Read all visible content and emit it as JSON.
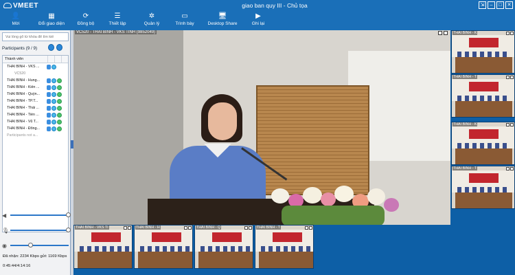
{
  "window": {
    "brand": "VMEET",
    "title": "giao ban quy III - Chủ tọa",
    "controls": [
      "restore",
      "minimize",
      "maximize",
      "close"
    ]
  },
  "toolbar": {
    "items": [
      {
        "label": "Mời",
        "icon": "add-user-icon"
      },
      {
        "label": "Đổi giao diện",
        "icon": "layout-icon"
      },
      {
        "label": "Đồng bộ",
        "icon": "sync-icon"
      },
      {
        "label": "Thiết lập",
        "icon": "settings-sliders-icon"
      },
      {
        "label": "Quản lý",
        "icon": "manage-icon"
      },
      {
        "label": "Trình bày",
        "icon": "present-icon"
      },
      {
        "label": "Desktop Share",
        "icon": "desktop-share-icon"
      },
      {
        "label": "Ghi lại",
        "icon": "record-icon"
      }
    ]
  },
  "sidebar": {
    "search_placeholder": "Vui lòng gõ từ khóa để tìm kiế",
    "participants_title": "Participants (9 / 9)",
    "column_header": "Thành viên",
    "participants": [
      {
        "name": "THÁI BÌNH - VKS ...",
        "icons": [
          "mic",
          "cam"
        ]
      },
      {
        "name": "VC520",
        "sub": true
      },
      {
        "name": "THÁI BÌNH - Hung...",
        "icons": [
          "mic",
          "cam",
          "green"
        ]
      },
      {
        "name": "THÁI BÌNH - Kiến ...",
        "icons": [
          "mic",
          "cam",
          "green"
        ]
      },
      {
        "name": "THÁI BÌNH - Quỳn...",
        "icons": [
          "mic",
          "cam",
          "green"
        ]
      },
      {
        "name": "THÁI BÌNH - TP.T...",
        "icons": [
          "mic",
          "cam",
          "green"
        ]
      },
      {
        "name": "THÁI BÌNH - Thái ...",
        "icons": [
          "mic",
          "cam",
          "green"
        ]
      },
      {
        "name": "THÁI BÌNH - Tiền ...",
        "icons": [
          "mic",
          "cam",
          "green"
        ]
      },
      {
        "name": "THÁI BÌNH - Vũ T...",
        "icons": [
          "mic",
          "cam",
          "green"
        ]
      },
      {
        "name": "THÁI BÌNH - Đông...",
        "icons": [
          "mic",
          "cam",
          "green"
        ]
      }
    ],
    "more_text": "Participants not a...",
    "volume": {
      "speaker": 1.0,
      "microphone": 1.0,
      "camera": 0.35
    },
    "status_bitrate": "Đã nhận: 2234 Kbps gửi: 1169 Kbps",
    "status_time": "0:45:44/4:14:16"
  },
  "main_video": {
    "label": "VC520 - THÁI BÌNH - VKS TỈNH (9852049)"
  },
  "right_thumbnails": [
    {
      "label": "THÁI BÌNH - K"
    },
    {
      "label": "THÁI BÌNH - T"
    },
    {
      "label": "THÁI BÌNH - K"
    },
    {
      "label": "THÁI BÌNH - T"
    }
  ],
  "bottom_thumbnails": [
    {
      "label": "THÁI BÌNH - VKS TỈ"
    },
    {
      "label": "THÁI BÌNH - H"
    },
    {
      "label": "THÁI BÌNH - Q"
    },
    {
      "label": "THÁI BÌNH - T"
    }
  ],
  "colors": {
    "accent": "#1a6fb8",
    "panel": "#f1f2f4",
    "background": "#0d5fa6"
  }
}
